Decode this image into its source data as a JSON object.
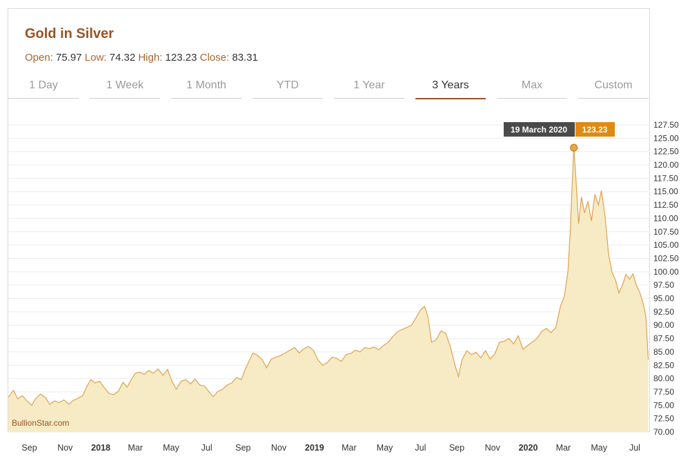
{
  "header": {
    "title": "Gold in Silver",
    "ohlc": [
      {
        "label": "Open:",
        "value": "75.97"
      },
      {
        "label": "Low:",
        "value": "74.32"
      },
      {
        "label": "High:",
        "value": "123.23"
      },
      {
        "label": "Close:",
        "value": "83.31"
      }
    ]
  },
  "tabs": [
    {
      "label": "1 Day",
      "active": false
    },
    {
      "label": "1 Week",
      "active": false
    },
    {
      "label": "1 Month",
      "active": false
    },
    {
      "label": "YTD",
      "active": false
    },
    {
      "label": "1 Year",
      "active": false
    },
    {
      "label": "3 Years",
      "active": true
    },
    {
      "label": "Max",
      "active": false
    },
    {
      "label": "Custom",
      "active": false
    }
  ],
  "watermark": "BullionStar.com",
  "tooltip": {
    "date": "19 March 2020",
    "value": "123.23"
  },
  "colors": {
    "accent": "#9a5322",
    "line": "#e0a050",
    "fill": "#f6ebc4",
    "tooltip_date_bg": "#4a4a4a",
    "tooltip_value_bg": "#e08a12",
    "marker": "#f2a33a"
  },
  "chart_data": {
    "type": "area",
    "title": "",
    "xlabel": "",
    "ylabel": "",
    "ylim": [
      70,
      127.5
    ],
    "y_ticks": [
      "70.00",
      "72.50",
      "75.00",
      "77.50",
      "80.00",
      "82.50",
      "85.00",
      "87.50",
      "90.00",
      "92.50",
      "95.00",
      "97.50",
      "100.00",
      "102.50",
      "105.00",
      "107.50",
      "110.00",
      "112.50",
      "115.00",
      "117.50",
      "120.00",
      "122.50",
      "125.00",
      "127.50"
    ],
    "x_ticks": [
      {
        "label": "Sep",
        "date": "2017-09-01",
        "bold": false
      },
      {
        "label": "Nov",
        "date": "2017-11-01",
        "bold": false
      },
      {
        "label": "2018",
        "date": "2018-01-01",
        "bold": true
      },
      {
        "label": "Mar",
        "date": "2018-03-01",
        "bold": false
      },
      {
        "label": "May",
        "date": "2018-05-01",
        "bold": false
      },
      {
        "label": "Jul",
        "date": "2018-07-01",
        "bold": false
      },
      {
        "label": "Sep",
        "date": "2018-09-01",
        "bold": false
      },
      {
        "label": "Nov",
        "date": "2018-11-01",
        "bold": false
      },
      {
        "label": "2019",
        "date": "2019-01-01",
        "bold": true
      },
      {
        "label": "Mar",
        "date": "2019-03-01",
        "bold": false
      },
      {
        "label": "May",
        "date": "2019-05-01",
        "bold": false
      },
      {
        "label": "Jul",
        "date": "2019-07-01",
        "bold": false
      },
      {
        "label": "Sep",
        "date": "2019-09-01",
        "bold": false
      },
      {
        "label": "Nov",
        "date": "2019-11-01",
        "bold": false
      },
      {
        "label": "2020",
        "date": "2020-01-01",
        "bold": true
      },
      {
        "label": "Mar",
        "date": "2020-03-01",
        "bold": false
      },
      {
        "label": "May",
        "date": "2020-05-01",
        "bold": false
      },
      {
        "label": "Jul",
        "date": "2020-07-01",
        "bold": false
      }
    ],
    "x_range": [
      "2017-07-27",
      "2020-07-27"
    ],
    "grid": true,
    "series": [
      {
        "points": [
          [
            "2017-07-27",
            76.5
          ],
          [
            "2017-08-05",
            77.8
          ],
          [
            "2017-08-12",
            76.2
          ],
          [
            "2017-08-20",
            76.8
          ],
          [
            "2017-08-28",
            75.8
          ],
          [
            "2017-09-05",
            75.0
          ],
          [
            "2017-09-12",
            76.3
          ],
          [
            "2017-09-20",
            77.1
          ],
          [
            "2017-09-28",
            76.5
          ],
          [
            "2017-10-06",
            75.2
          ],
          [
            "2017-10-14",
            75.8
          ],
          [
            "2017-10-22",
            75.5
          ],
          [
            "2017-10-30",
            76.0
          ],
          [
            "2017-11-07",
            75.2
          ],
          [
            "2017-11-15",
            75.9
          ],
          [
            "2017-11-23",
            76.3
          ],
          [
            "2017-12-01",
            76.8
          ],
          [
            "2017-12-08",
            78.5
          ],
          [
            "2017-12-15",
            79.8
          ],
          [
            "2017-12-22",
            79.2
          ],
          [
            "2017-12-30",
            79.5
          ],
          [
            "2018-01-07",
            78.3
          ],
          [
            "2018-01-15",
            77.2
          ],
          [
            "2018-01-23",
            77.0
          ],
          [
            "2018-01-31",
            77.6
          ],
          [
            "2018-02-08",
            79.3
          ],
          [
            "2018-02-15",
            78.4
          ],
          [
            "2018-02-22",
            79.8
          ],
          [
            "2018-03-01",
            81.0
          ],
          [
            "2018-03-08",
            81.2
          ],
          [
            "2018-03-16",
            80.8
          ],
          [
            "2018-03-24",
            81.5
          ],
          [
            "2018-04-01",
            81.0
          ],
          [
            "2018-04-09",
            81.8
          ],
          [
            "2018-04-17",
            80.6
          ],
          [
            "2018-04-25",
            81.7
          ],
          [
            "2018-05-03",
            79.4
          ],
          [
            "2018-05-10",
            78.0
          ],
          [
            "2018-05-18",
            79.5
          ],
          [
            "2018-05-26",
            79.8
          ],
          [
            "2018-06-03",
            79.0
          ],
          [
            "2018-06-11",
            79.9
          ],
          [
            "2018-06-19",
            78.8
          ],
          [
            "2018-06-27",
            78.6
          ],
          [
            "2018-07-05",
            77.5
          ],
          [
            "2018-07-12",
            76.6
          ],
          [
            "2018-07-20",
            77.6
          ],
          [
            "2018-07-28",
            78.0
          ],
          [
            "2018-08-05",
            78.8
          ],
          [
            "2018-08-13",
            79.2
          ],
          [
            "2018-08-21",
            80.2
          ],
          [
            "2018-08-29",
            79.8
          ],
          [
            "2018-09-05",
            81.8
          ],
          [
            "2018-09-10",
            83.0
          ],
          [
            "2018-09-18",
            84.8
          ],
          [
            "2018-09-26",
            84.3
          ],
          [
            "2018-10-04",
            83.5
          ],
          [
            "2018-10-11",
            82.0
          ],
          [
            "2018-10-19",
            83.6
          ],
          [
            "2018-10-27",
            84.0
          ],
          [
            "2018-11-04",
            84.3
          ],
          [
            "2018-11-12",
            84.8
          ],
          [
            "2018-11-20",
            85.3
          ],
          [
            "2018-11-28",
            85.8
          ],
          [
            "2018-12-06",
            84.8
          ],
          [
            "2018-12-14",
            85.6
          ],
          [
            "2018-12-22",
            86.0
          ],
          [
            "2018-12-30",
            85.3
          ],
          [
            "2019-01-07",
            83.5
          ],
          [
            "2019-01-15",
            82.5
          ],
          [
            "2019-01-23",
            83.0
          ],
          [
            "2019-01-31",
            84.0
          ],
          [
            "2019-02-08",
            83.8
          ],
          [
            "2019-02-16",
            83.2
          ],
          [
            "2019-02-24",
            84.5
          ],
          [
            "2019-03-04",
            84.7
          ],
          [
            "2019-03-12",
            85.3
          ],
          [
            "2019-03-20",
            85.0
          ],
          [
            "2019-03-28",
            85.8
          ],
          [
            "2019-04-05",
            85.6
          ],
          [
            "2019-04-13",
            85.9
          ],
          [
            "2019-04-21",
            85.4
          ],
          [
            "2019-04-29",
            86.2
          ],
          [
            "2019-05-07",
            86.8
          ],
          [
            "2019-05-15",
            87.9
          ],
          [
            "2019-05-23",
            88.8
          ],
          [
            "2019-05-31",
            89.2
          ],
          [
            "2019-06-08",
            89.6
          ],
          [
            "2019-06-16",
            90.0
          ],
          [
            "2019-06-24",
            91.5
          ],
          [
            "2019-07-02",
            93.0
          ],
          [
            "2019-07-08",
            93.5
          ],
          [
            "2019-07-14",
            91.5
          ],
          [
            "2019-07-20",
            86.8
          ],
          [
            "2019-07-28",
            87.3
          ],
          [
            "2019-08-05",
            88.9
          ],
          [
            "2019-08-13",
            88.5
          ],
          [
            "2019-08-21",
            86.0
          ],
          [
            "2019-08-29",
            82.5
          ],
          [
            "2019-09-04",
            80.4
          ],
          [
            "2019-09-10",
            83.5
          ],
          [
            "2019-09-18",
            85.2
          ],
          [
            "2019-09-26",
            84.5
          ],
          [
            "2019-10-04",
            84.9
          ],
          [
            "2019-10-12",
            83.9
          ],
          [
            "2019-10-20",
            85.2
          ],
          [
            "2019-10-28",
            83.7
          ],
          [
            "2019-11-05",
            84.6
          ],
          [
            "2019-11-13",
            86.8
          ],
          [
            "2019-11-21",
            87.0
          ],
          [
            "2019-11-29",
            87.5
          ],
          [
            "2019-12-07",
            86.5
          ],
          [
            "2019-12-15",
            88.0
          ],
          [
            "2019-12-23",
            85.5
          ],
          [
            "2019-12-31",
            86.2
          ],
          [
            "2020-01-08",
            86.8
          ],
          [
            "2020-01-16",
            87.5
          ],
          [
            "2020-01-24",
            88.8
          ],
          [
            "2020-02-01",
            89.4
          ],
          [
            "2020-02-09",
            88.6
          ],
          [
            "2020-02-17",
            89.5
          ],
          [
            "2020-02-25",
            93.5
          ],
          [
            "2020-03-03",
            95.5
          ],
          [
            "2020-03-09",
            100.2
          ],
          [
            "2020-03-13",
            108.0
          ],
          [
            "2020-03-16",
            116.0
          ],
          [
            "2020-03-19",
            123.23
          ],
          [
            "2020-03-23",
            116.5
          ],
          [
            "2020-03-27",
            109.0
          ],
          [
            "2020-04-01",
            114.0
          ],
          [
            "2020-04-06",
            111.0
          ],
          [
            "2020-04-12",
            113.2
          ],
          [
            "2020-04-18",
            109.5
          ],
          [
            "2020-04-24",
            114.5
          ],
          [
            "2020-04-30",
            112.5
          ],
          [
            "2020-05-05",
            115.2
          ],
          [
            "2020-05-11",
            110.6
          ],
          [
            "2020-05-17",
            103.5
          ],
          [
            "2020-05-23",
            100.0
          ],
          [
            "2020-05-29",
            98.5
          ],
          [
            "2020-06-04",
            96.0
          ],
          [
            "2020-06-10",
            97.5
          ],
          [
            "2020-06-16",
            99.5
          ],
          [
            "2020-06-22",
            98.6
          ],
          [
            "2020-06-28",
            99.6
          ],
          [
            "2020-07-04",
            97.4
          ],
          [
            "2020-07-10",
            96.0
          ],
          [
            "2020-07-16",
            93.8
          ],
          [
            "2020-07-20",
            91.5
          ],
          [
            "2020-07-24",
            83.5
          ]
        ]
      }
    ]
  }
}
